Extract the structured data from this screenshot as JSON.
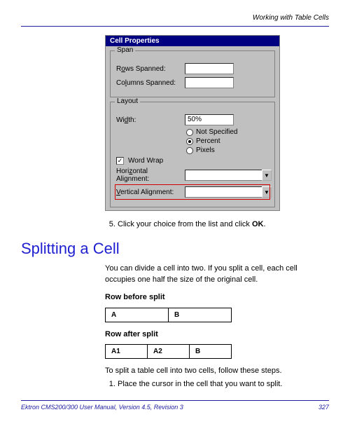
{
  "header": {
    "section_title": "Working with Table Cells"
  },
  "dialog": {
    "title": "Cell Properties",
    "span": {
      "group_label": "Span",
      "rows_label_pre": "R",
      "rows_label_ul": "o",
      "rows_label_post": "ws Spanned:",
      "cols_label_pre": "Co",
      "cols_label_ul": "l",
      "cols_label_post": "umns Spanned:",
      "rows_value": "",
      "cols_value": ""
    },
    "layout": {
      "group_label": "Layout",
      "width_label_pre": "Wi",
      "width_label_ul": "d",
      "width_label_post": "th:",
      "width_value": "50%",
      "radio_notspec_pre": "",
      "radio_notspec_ul": "N",
      "radio_notspec_post": "ot Specified",
      "radio_percent_pre": "P",
      "radio_percent_ul": "e",
      "radio_percent_post": "rcent",
      "radio_pixels_pre": "Pi",
      "radio_pixels_ul": "x",
      "radio_pixels_post": "els",
      "wordwrap_label_pre": "Word ",
      "wordwrap_label_ul": "W",
      "wordwrap_label_post": "rap",
      "wordwrap_checked": "✓",
      "halign_label_pre": "Hori",
      "halign_label_ul": "z",
      "halign_label_post": "ontal Alignment:",
      "halign_value": "",
      "valign_label_pre": "",
      "valign_label_ul": "V",
      "valign_label_post": "ertical Alignment:",
      "valign_value": ""
    }
  },
  "step5": {
    "num": "5.",
    "text_pre": "Click your choice from the list and click ",
    "bold": "OK",
    "text_post": "."
  },
  "splitting": {
    "heading": "Splitting a Cell",
    "intro": "You can divide a cell into two. If you split a cell, each cell occupies one half the size of the original cell.",
    "before_label": "Row before split",
    "after_label": "Row after split",
    "before_cells": {
      "a": "A",
      "b": "B"
    },
    "after_cells": {
      "a1": "A1",
      "a2": "A2",
      "b": "B"
    },
    "outro": "To split a table cell into two cells, follow these steps.",
    "step1_num": "1.",
    "step1_text": "Place the cursor in the cell that you want to split."
  },
  "footer": {
    "left": "Ektron CMS200/300 User Manual, Version 4.5, Revision 3",
    "right": "327"
  }
}
